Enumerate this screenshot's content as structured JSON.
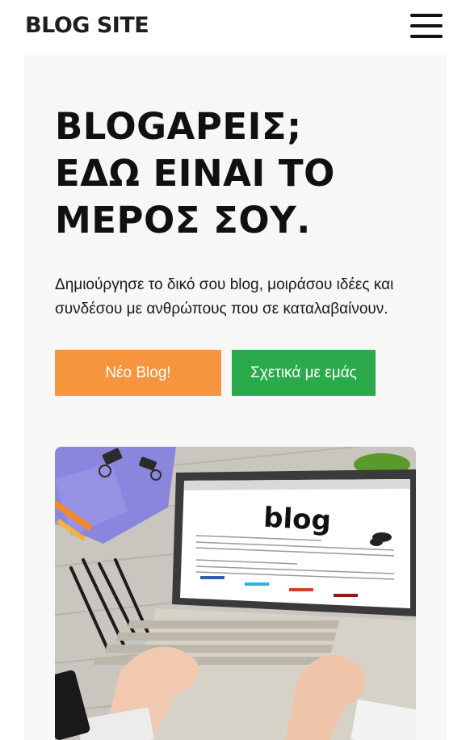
{
  "header": {
    "brand": "BLOG SITE",
    "menu_icon": "hamburger-menu-icon"
  },
  "hero": {
    "title_lines": [
      "BLOGΑΡΕΙΣ;",
      "ΕΔΩ ΕΙΝΑΙ ΤΟ",
      "ΜΕΡΟΣ ΣΟΥ."
    ],
    "description": "Δημιούργησε το δικό σου blog, μοιράσου ιδέες και συνδέσου με ανθρώπους που σε καταλαβαίνουν.",
    "buttons": {
      "new_blog": "Νέο Blog!",
      "about": "Σχετικά με εμάς"
    },
    "image": {
      "screen_word": "blog",
      "colors": {
        "accent_orange": "#f7953e",
        "accent_green": "#2aaa4a"
      }
    }
  }
}
